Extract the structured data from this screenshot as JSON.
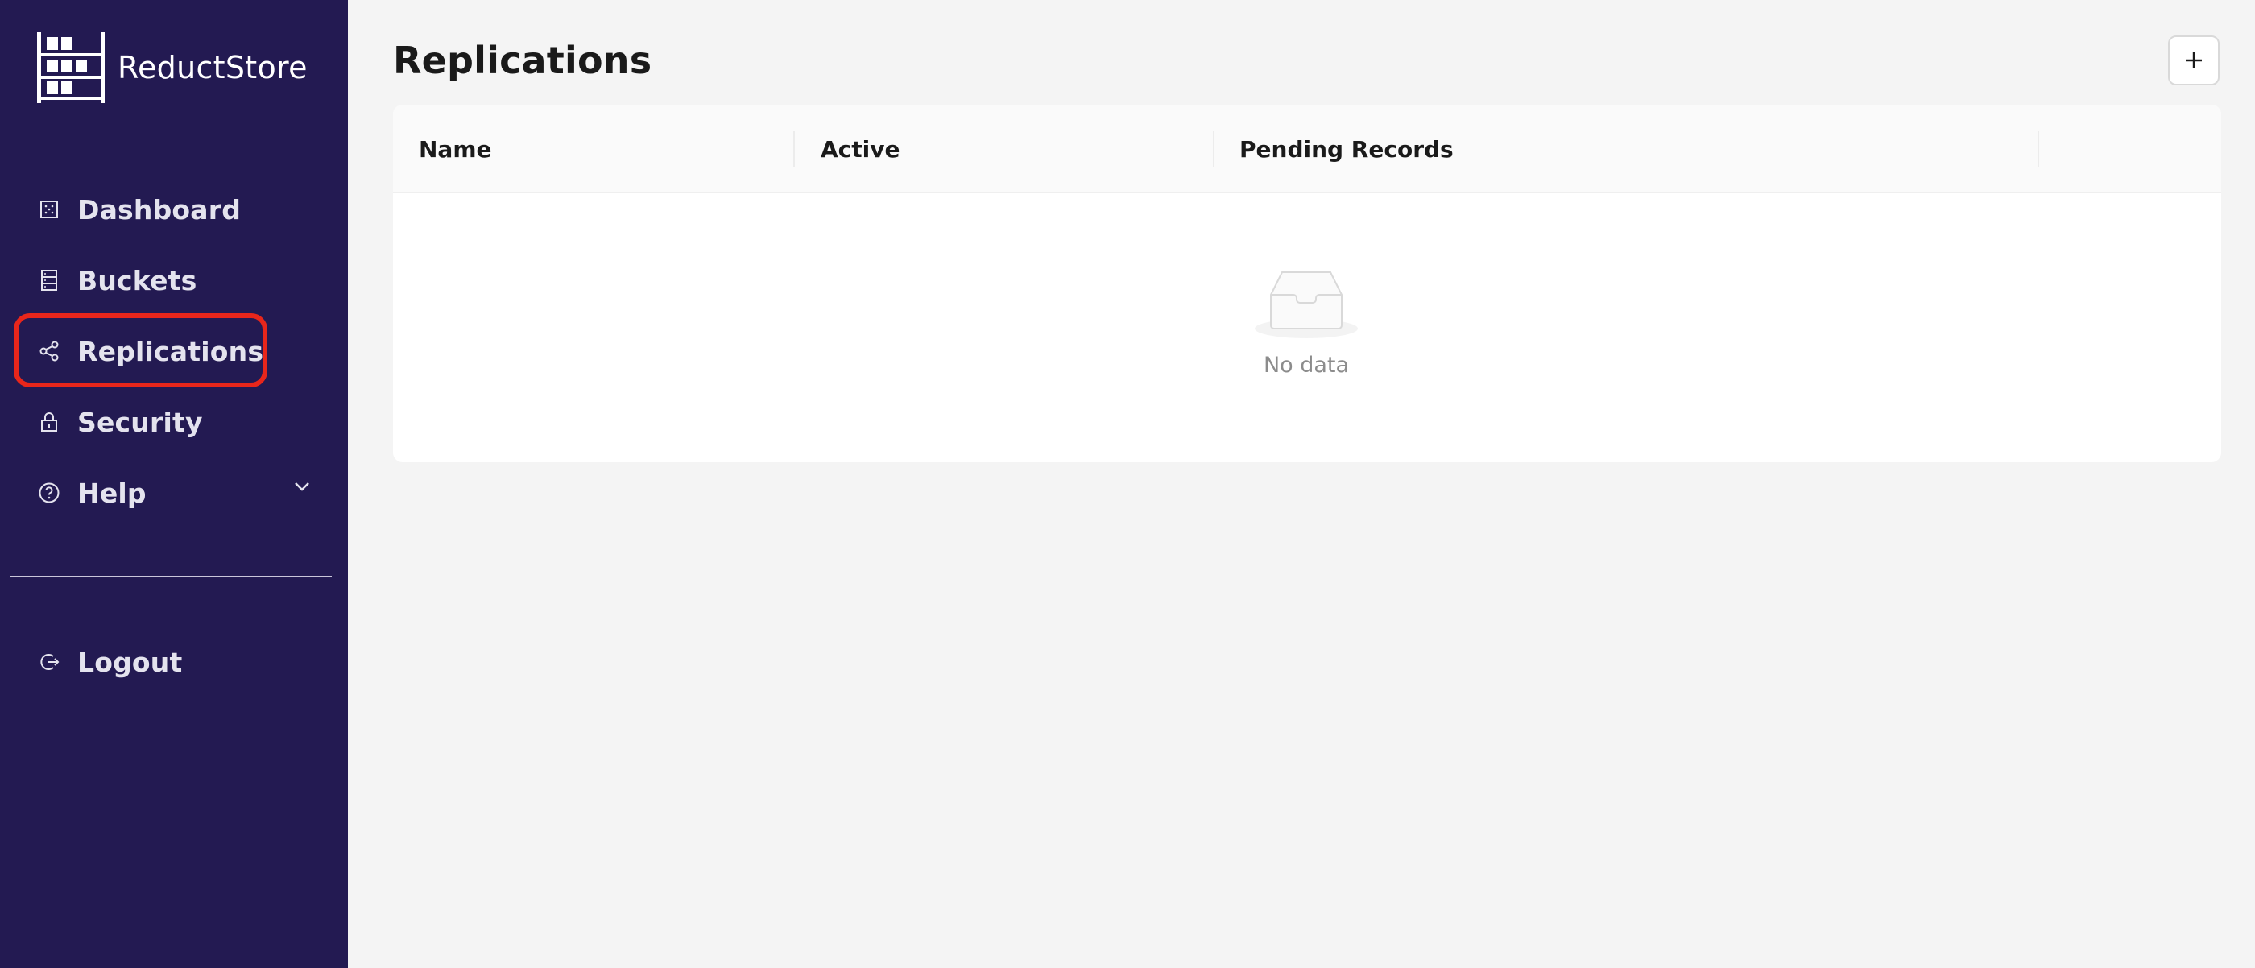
{
  "app": {
    "name": "ReductStore"
  },
  "sidebar": {
    "items": [
      {
        "label": "Dashboard",
        "icon": "dashboard-icon"
      },
      {
        "label": "Buckets",
        "icon": "buckets-icon"
      },
      {
        "label": "Replications",
        "icon": "share-icon",
        "selected": true
      },
      {
        "label": "Security",
        "icon": "lock-icon"
      },
      {
        "label": "Help",
        "icon": "help-icon",
        "expandable": true
      }
    ],
    "logout": {
      "label": "Logout",
      "icon": "logout-icon"
    }
  },
  "main": {
    "title": "Replications",
    "add_button_icon": "plus-icon",
    "table": {
      "columns": [
        "Name",
        "Active",
        "Pending Records",
        ""
      ],
      "rows": [],
      "empty_text": "No data"
    }
  },
  "colors": {
    "sidebar_bg": "#231a52",
    "highlight": "#e8261b",
    "page_bg": "#f4f4f4"
  }
}
